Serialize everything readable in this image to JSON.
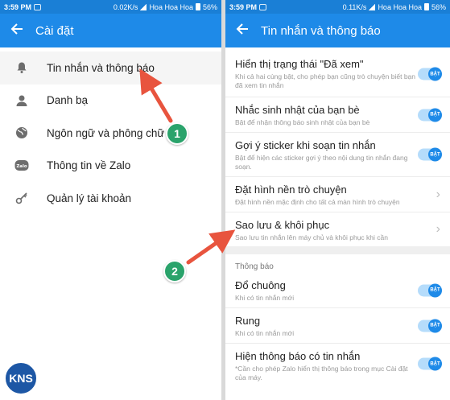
{
  "left_screen": {
    "status": {
      "time": "3:59 PM",
      "speed": "0.02K/s",
      "carrier": "Hoa Hoa Hoa",
      "battery": "56%"
    },
    "appbar": {
      "back_icon": "arrow-back-icon",
      "title": "Cài đặt"
    },
    "menu": [
      {
        "icon": "bell-icon",
        "label": "Tin nhắn và thông báo"
      },
      {
        "icon": "person-icon",
        "label": "Danh bạ"
      },
      {
        "icon": "globe-icon",
        "label": "Ngôn ngữ và phông chữ"
      },
      {
        "icon": "zalo-icon",
        "label": "Thông tin về Zalo"
      },
      {
        "icon": "key-icon",
        "label": "Quản lý tài khoản"
      }
    ]
  },
  "right_screen": {
    "status": {
      "time": "3:59 PM",
      "speed": "0.11K/s",
      "carrier": "Hoa Hoa Hoa",
      "battery": "56%"
    },
    "appbar": {
      "back_icon": "arrow-back-icon",
      "title": "Tin nhắn và thông báo"
    },
    "settings": [
      {
        "title": "Hiển thị trạng thái \"Đã xem\"",
        "subtitle": "Khi cả hai cùng bật, cho phép bạn cũng trò chuyện biết bạn đã xem tin nhắn",
        "control": "toggle",
        "state": "BẬT"
      },
      {
        "title": "Nhắc sinh nhật của bạn bè",
        "subtitle": "Bật để nhận thông báo sinh nhật của bạn bè",
        "control": "toggle",
        "state": "BẬT"
      },
      {
        "title": "Gợi ý sticker khi soạn tin nhắn",
        "subtitle": "Bật để hiện các sticker gợi ý theo nội dung tin nhắn đang soạn.",
        "control": "toggle",
        "state": "BẬT"
      },
      {
        "title": "Đặt hình nền trò chuyện",
        "subtitle": "Đặt hình nền mặc định cho tất cả màn hình trò chuyện",
        "control": "chevron"
      },
      {
        "title": "Sao lưu & khôi phục",
        "subtitle": "Sao lưu tin nhắn lên máy chủ và khôi phục khi cần",
        "control": "chevron"
      }
    ],
    "section_title": "Thông báo",
    "notifications": [
      {
        "title": "Đổ chuông",
        "subtitle": "Khi có tin nhắn mới",
        "state": "BẬT"
      },
      {
        "title": "Rung",
        "subtitle": "Khi có tin nhắn mới",
        "state": "BẬT"
      },
      {
        "title": "Hiện thông báo có tin nhắn",
        "subtitle": "*Cần cho phép Zalo hiển thị thông báo trong mục Cài đặt của máy.",
        "state": "BẬT"
      }
    ]
  },
  "annotations": {
    "step1": "1",
    "step2": "2",
    "arrow_color": "#e8543e",
    "badge_color": "#2aa36b"
  },
  "watermark": {
    "text": "KNS"
  },
  "colors": {
    "appbar": "#1e8ae8",
    "statusbar": "#1a7fd6",
    "toggle_on": "#1e8ae8"
  }
}
